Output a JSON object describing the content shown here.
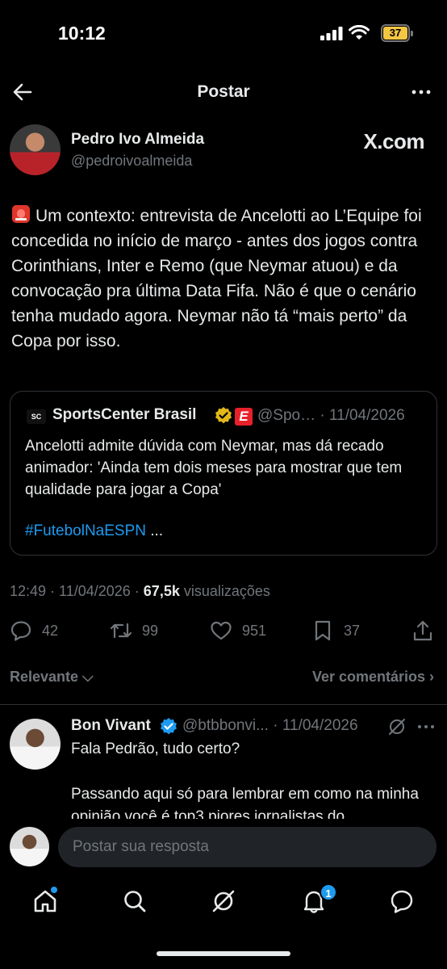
{
  "status_bar": {
    "time": "10:12",
    "battery": "37"
  },
  "header": {
    "title": "Postar"
  },
  "author": {
    "name": "Pedro Ivo Almeida",
    "handle": "@pedroivoalmeida",
    "source_badge": "X.com"
  },
  "post": {
    "text": "Um contexto: entrevista de Ancelotti ao L’Equipe foi concedida no início de março - antes dos jogos contra Corinthians, Inter e Remo (que Neymar atuou) e da convocação pra última Data Fifa. Não é que o cenário tenha mudado agora. Neymar não tá “mais perto” da Copa por isso."
  },
  "quote": {
    "avatar_text": "SC",
    "name": "SportsCenter Brasil",
    "badge_letter": "E",
    "meta": "@Spo… · 11/04/2026",
    "text": "Ancelotti admite dúvida com Neymar, mas dá recado animador: 'Ainda tem dois meses para mostrar que tem qualidade para jogar a Copa'",
    "hashtag": "#FutebolNaESPN",
    "ellipsis": " ..."
  },
  "meta": {
    "timestamp": "12:49 · 11/04/2026 · ",
    "views": "67,5k",
    "views_label": " visualizações"
  },
  "actions": {
    "replies": "42",
    "reposts": "99",
    "likes": "951",
    "bookmarks": "37"
  },
  "sort": {
    "relevant": "Relevante ⌵",
    "see_comments": "Ver comentários ›"
  },
  "reply": {
    "name": "Bon Vivant",
    "meta": "@btbbonvi... · 11/04/2026",
    "line1": "Fala Pedrão, tudo certo?",
    "line2": "Passando aqui só para lembrar em como na minha opinião você é top3 piores jornalistas do"
  },
  "compose": {
    "placeholder": "Postar sua resposta"
  },
  "nav": {
    "notifications_badge": "1"
  },
  "colors": {
    "accent": "#1d9bf0",
    "background": "#000000",
    "muted": "#71767b",
    "text": "#e7e9ea"
  }
}
